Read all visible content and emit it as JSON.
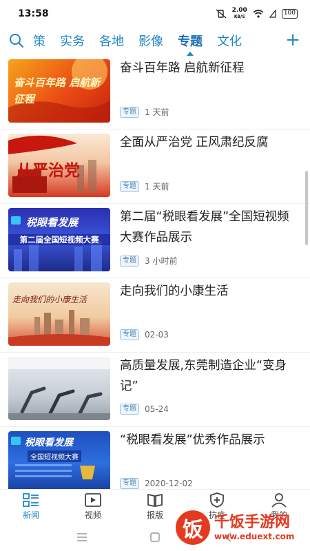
{
  "status": {
    "time": "13:58",
    "speed_value": "2.00",
    "speed_unit": "KB/S",
    "battery": "100"
  },
  "nav": {
    "tabs": [
      {
        "label": "策",
        "active": false
      },
      {
        "label": "实务",
        "active": false
      },
      {
        "label": "各地",
        "active": false
      },
      {
        "label": "影像",
        "active": false
      },
      {
        "label": "专题",
        "active": true
      },
      {
        "label": "文化",
        "active": false
      }
    ],
    "plus": "+"
  },
  "articles": [
    {
      "title": "奋斗百年路 启航新征程",
      "tag": "专题",
      "time": "1 天前",
      "thumb_text": "奋斗百年路 启航新征程"
    },
    {
      "title": "全面从严治党 正风肃纪反腐",
      "tag": "专题",
      "time": "1 天前",
      "thumb_text": "从严治党"
    },
    {
      "title": "第二届“税眼看发展”全国短视频大赛作品展示",
      "tag": "专题",
      "time": "3 小时前",
      "thumb_text": "税眼看发展",
      "thumb_sub": "第二届全国短视频大赛"
    },
    {
      "title": "走向我们的小康生活",
      "tag": "专题",
      "time": "02-03",
      "thumb_text": "走向我们的小康生活"
    },
    {
      "title": "高质量发展,东莞制造企业“变身记”",
      "tag": "专题",
      "time": "05-24"
    },
    {
      "title": "“税眼看发展”优秀作品展示",
      "tag": "专题",
      "time": "2020-12-02",
      "thumb_text": "税眼看发展",
      "thumb_sub": "全国短视频大赛"
    }
  ],
  "bottom_nav": [
    {
      "label": "新闻",
      "icon": "news-icon",
      "active": true
    },
    {
      "label": "视频",
      "icon": "video-icon",
      "active": false
    },
    {
      "label": "报版",
      "icon": "newspaper-icon",
      "active": false
    },
    {
      "label": "抗疫",
      "icon": "shield-plus-icon",
      "active": false
    },
    {
      "label": "我的",
      "icon": "user-icon",
      "active": false
    }
  ],
  "watermark": {
    "logo": "饭",
    "name": "千饭手游网",
    "url": "www.eduext.com"
  },
  "colors": {
    "accent": "#1f86c9",
    "tag_border": "#9cc3e4",
    "watermark": "#e53a1f"
  }
}
